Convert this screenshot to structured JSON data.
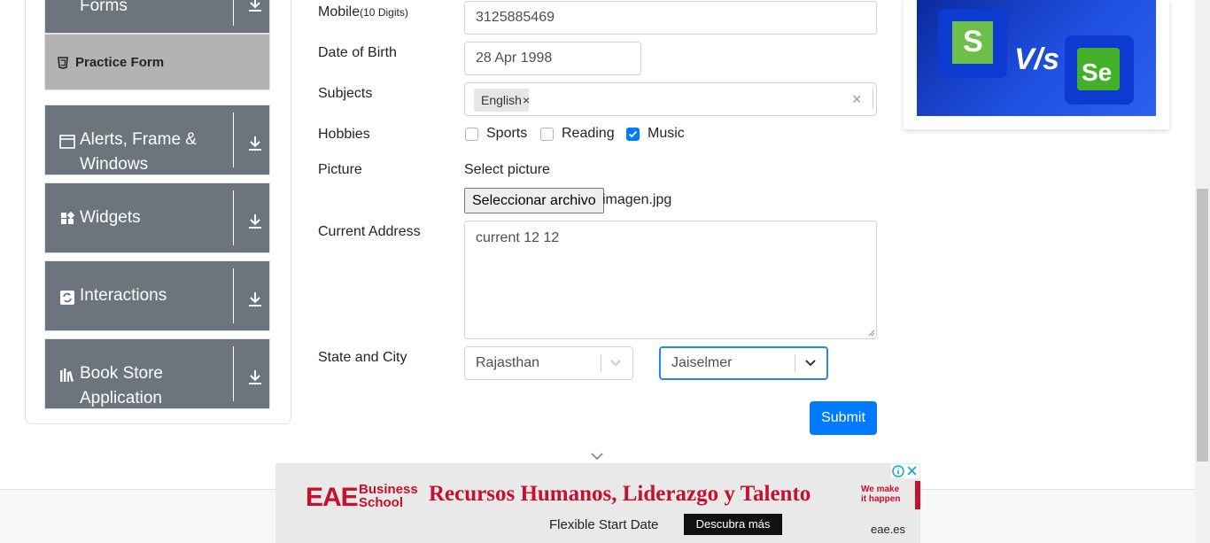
{
  "sidebar": {
    "forms_label": "Forms",
    "practice_form": "Practice Form",
    "groups": [
      {
        "label": "Alerts, Frame & Windows",
        "icon": "window-icon"
      },
      {
        "label": "Widgets",
        "icon": "widgets-icon"
      },
      {
        "label": "Interactions",
        "icon": "interactions-icon"
      },
      {
        "label": "Book Store Application",
        "icon": "books-icon"
      }
    ]
  },
  "form": {
    "mobile_label": "Mobile",
    "mobile_hint": "(10 Digits)",
    "mobile_value": "3125885469",
    "dob_label": "Date of Birth",
    "dob_value": "28 Apr 1998",
    "subjects_label": "Subjects",
    "subjects_selected": [
      "English"
    ],
    "hobbies_label": "Hobbies",
    "hobbies": [
      {
        "label": "Sports",
        "checked": false
      },
      {
        "label": "Reading",
        "checked": false
      },
      {
        "label": "Music",
        "checked": true
      }
    ],
    "picture_label": "Picture",
    "picture_prompt": "Select picture",
    "file_button": "Seleccionar archivo",
    "file_name": "imagen.jpg",
    "address_label": "Current Address",
    "address_value": "current 12 12",
    "state_city_label": "State and City",
    "state_value": "Rajasthan",
    "city_value": "Jaiselmer",
    "submit_label": "Submit"
  },
  "right_ad": {
    "vs_text": "V/s",
    "left_letter": "S",
    "right_letters": "Se"
  },
  "bottom_ad": {
    "brand": "EAE",
    "brand_sub_1": "Business",
    "brand_sub_2": "School",
    "headline": "Recursos Humanos, Liderazgo y Talento",
    "tagline_1": "We make",
    "tagline_2": "it happen",
    "sub": "Flexible Start Date",
    "cta": "Descubra más",
    "domain": "eae.es"
  },
  "colors": {
    "accent": "#007bff",
    "sidebar_bg": "#6c757d",
    "active_bg": "#b3b3b3",
    "ad_red": "#c8102e"
  }
}
